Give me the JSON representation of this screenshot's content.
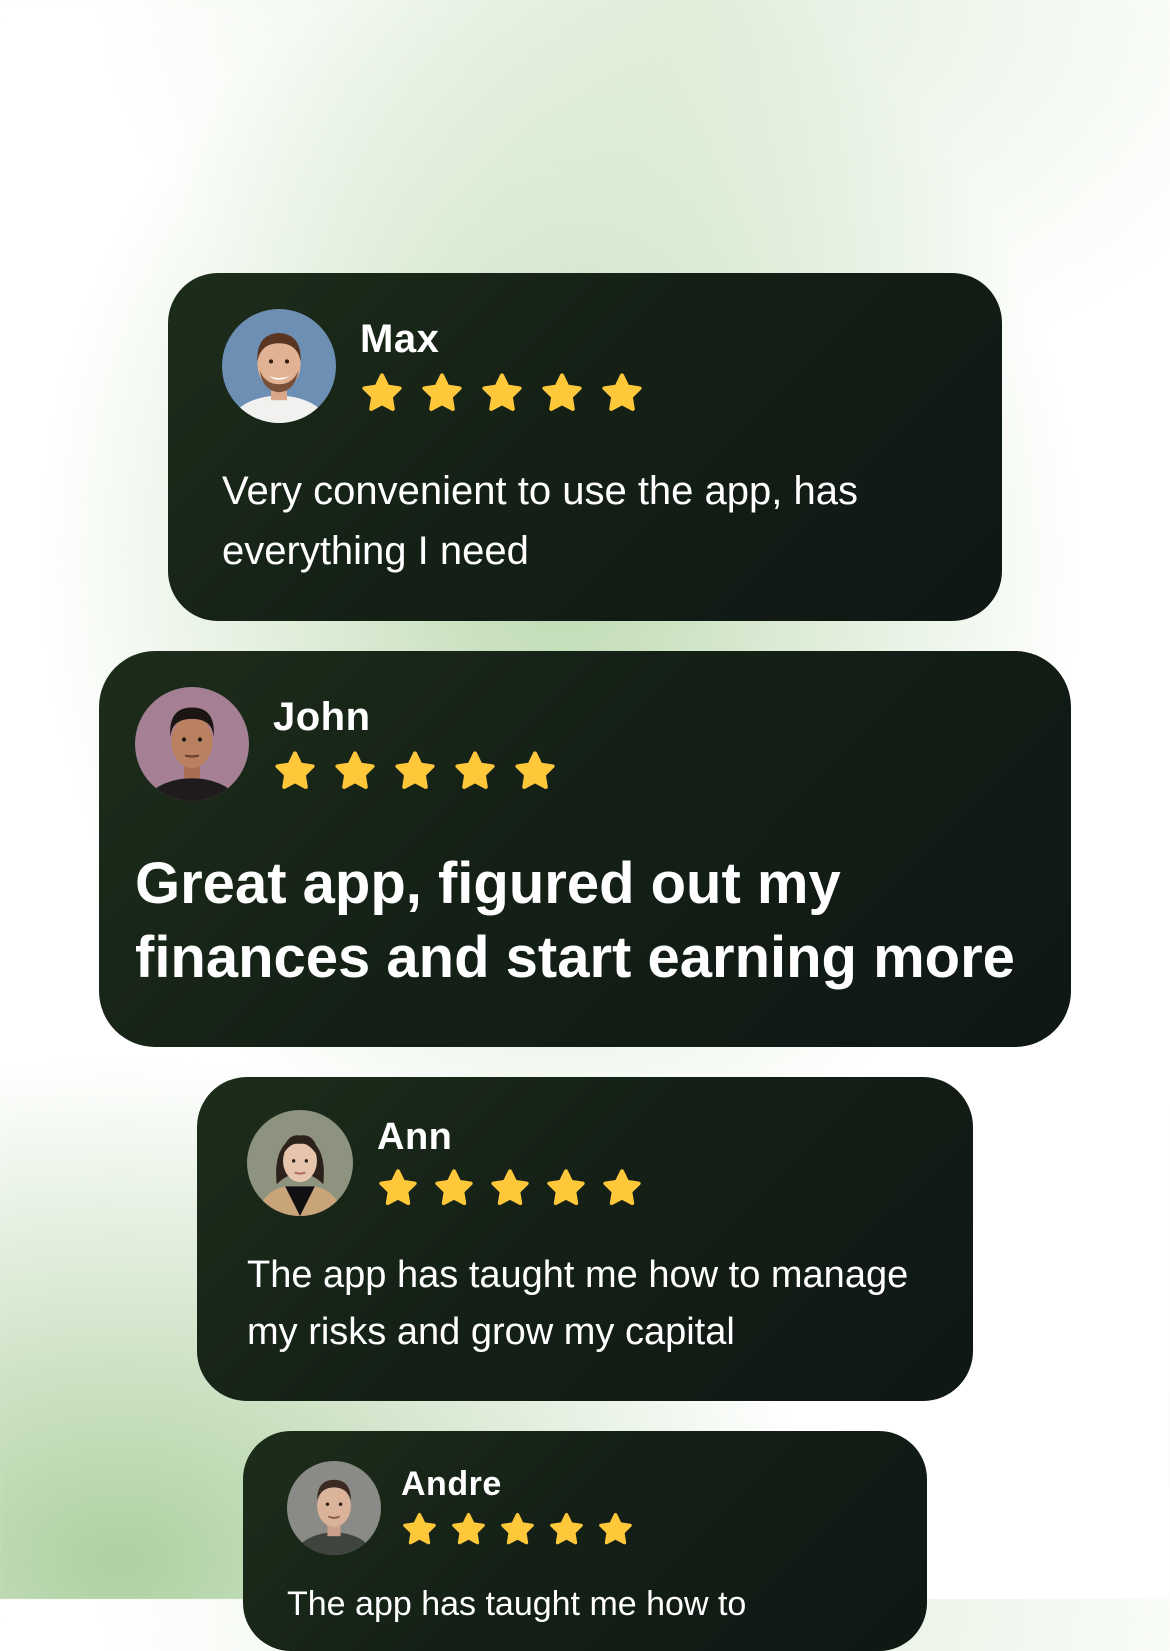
{
  "theme": {
    "card_background": "#142016",
    "star_color": "#FFC83A",
    "text_color": "#FFFFFF",
    "glow_color": "#B2D4A4"
  },
  "reviews": [
    {
      "name": "Max",
      "rating": 5,
      "max_rating": 5,
      "text": "Very convenient to use the app, has everything I need",
      "avatar_icon": "avatar-photo-man-smiling"
    },
    {
      "name": "John",
      "rating": 5,
      "max_rating": 5,
      "text": "Great app, figured out my finances and start earning more",
      "avatar_icon": "avatar-photo-man"
    },
    {
      "name": "Ann",
      "rating": 5,
      "max_rating": 5,
      "text": "The app has taught me how to manage  my risks and grow my capital",
      "avatar_icon": "avatar-photo-woman"
    },
    {
      "name": "Andre",
      "rating": 5,
      "max_rating": 5,
      "text": "The app has taught me how to",
      "avatar_icon": "avatar-photo-man"
    }
  ]
}
